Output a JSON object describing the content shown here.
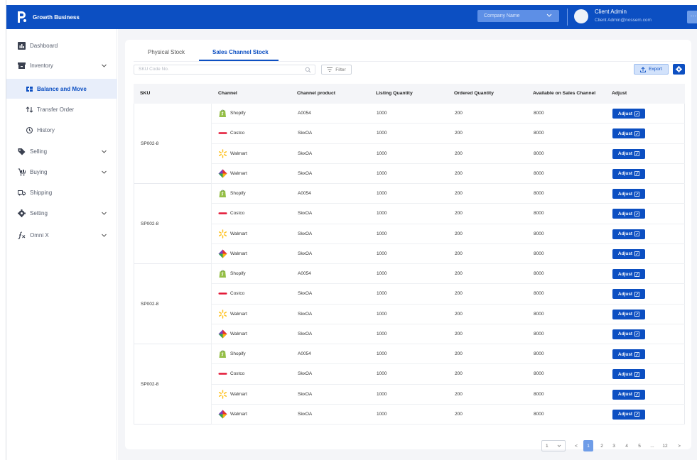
{
  "app": {
    "name": "Growth Business"
  },
  "header": {
    "company_placeholder": "Company Name",
    "user_name": "Client Admin",
    "user_email": "Client Admin@nossem.com",
    "more_label": "···"
  },
  "sidebar": {
    "items": [
      {
        "label": "Dashboard",
        "icon": "dashboard-icon"
      },
      {
        "label": "Inventory",
        "icon": "inventory-icon",
        "expandable": true
      },
      {
        "label": "Balance and Move",
        "icon": "balance-icon",
        "active": true
      },
      {
        "label": "Transfer Order",
        "icon": "transfer-icon"
      },
      {
        "label": "History",
        "icon": "history-icon"
      },
      {
        "label": "Selling",
        "icon": "tag-icon",
        "expandable": true
      },
      {
        "label": "Buying",
        "icon": "buying-icon",
        "expandable": true
      },
      {
        "label": "Shipping",
        "icon": "truck-icon"
      },
      {
        "label": "Setting",
        "icon": "gear-icon",
        "expandable": true
      },
      {
        "label": "Omni X",
        "icon": "function-icon",
        "expandable": true
      }
    ]
  },
  "tabs": [
    {
      "label": "Physical Stock",
      "active": false
    },
    {
      "label": "Sales Channel Stock",
      "active": true
    }
  ],
  "toolbar": {
    "search_placeholder": "SKU Code No.",
    "filter_label": "Filter",
    "export_label": "Export"
  },
  "table": {
    "columns": [
      "SKU",
      "Channel",
      "Channel product",
      "Listing Quantity",
      "Ordered Quantity",
      "Available on Sales Channel",
      "Adjust"
    ],
    "groups": [
      {
        "sku": "SP002-8",
        "rows": [
          {
            "channel": "Shopify",
            "icon": "shopify-icon",
            "product": "A0054",
            "listing": "1000",
            "ordered": "200",
            "available": "8000",
            "action": "Adjust"
          },
          {
            "channel": "Costco",
            "icon": "costco-icon",
            "product": "SkxOA",
            "listing": "1000",
            "ordered": "200",
            "available": "8000",
            "action": "Adjust"
          },
          {
            "channel": "Walmart",
            "icon": "walmart-spark-icon",
            "product": "SkxOA",
            "listing": "1000",
            "ordered": "200",
            "available": "8000",
            "action": "Adjust"
          },
          {
            "channel": "Walmart",
            "icon": "walmart-cube-icon",
            "product": "SkxOA",
            "listing": "1000",
            "ordered": "200",
            "available": "8000",
            "action": "Adjust"
          }
        ]
      },
      {
        "sku": "SP002-8",
        "rows": [
          {
            "channel": "Shopify",
            "icon": "shopify-icon",
            "product": "A0054",
            "listing": "1000",
            "ordered": "200",
            "available": "8000",
            "action": "Adjust"
          },
          {
            "channel": "Costco",
            "icon": "costco-icon",
            "product": "SkxOA",
            "listing": "1000",
            "ordered": "200",
            "available": "8000",
            "action": "Adjust"
          },
          {
            "channel": "Walmart",
            "icon": "walmart-spark-icon",
            "product": "SkxOA",
            "listing": "1000",
            "ordered": "200",
            "available": "8000",
            "action": "Adjust"
          },
          {
            "channel": "Walmart",
            "icon": "walmart-cube-icon",
            "product": "SkxOA",
            "listing": "1000",
            "ordered": "200",
            "available": "8000",
            "action": "Adjust"
          }
        ]
      },
      {
        "sku": "SP002-8",
        "rows": [
          {
            "channel": "Shopify",
            "icon": "shopify-icon",
            "product": "A0054",
            "listing": "1000",
            "ordered": "200",
            "available": "8000",
            "action": "Adjust"
          },
          {
            "channel": "Costco",
            "icon": "costco-icon",
            "product": "SkxOA",
            "listing": "1000",
            "ordered": "200",
            "available": "8000",
            "action": "Adjust"
          },
          {
            "channel": "Walmart",
            "icon": "walmart-spark-icon",
            "product": "SkxOA",
            "listing": "1000",
            "ordered": "200",
            "available": "8000",
            "action": "Adjust"
          },
          {
            "channel": "Walmart",
            "icon": "walmart-cube-icon",
            "product": "SkxOA",
            "listing": "1000",
            "ordered": "200",
            "available": "8000",
            "action": "Adjust"
          }
        ]
      },
      {
        "sku": "SP002-8",
        "rows": [
          {
            "channel": "Shopify",
            "icon": "shopify-icon",
            "product": "A0054",
            "listing": "1000",
            "ordered": "200",
            "available": "8000",
            "action": "Adjust"
          },
          {
            "channel": "Costco",
            "icon": "costco-icon",
            "product": "SkxOA",
            "listing": "1000",
            "ordered": "200",
            "available": "8000",
            "action": "Adjust"
          },
          {
            "channel": "Walmart",
            "icon": "walmart-spark-icon",
            "product": "SkxOA",
            "listing": "1000",
            "ordered": "200",
            "available": "8000",
            "action": "Adjust"
          },
          {
            "channel": "Walmart",
            "icon": "walmart-cube-icon",
            "product": "SkxOA",
            "listing": "1000",
            "ordered": "200",
            "available": "8000",
            "action": "Adjust"
          }
        ]
      }
    ]
  },
  "pagination": {
    "page_size": "1",
    "prev": "<",
    "next": ">",
    "pages": [
      "1",
      "2",
      "3",
      "4",
      "5",
      "...",
      "12"
    ],
    "current": "1"
  },
  "colors": {
    "primary": "#0c4fc2",
    "shopify": "#95bf47",
    "costco": "#e31837",
    "walmart": "#ffc220"
  }
}
